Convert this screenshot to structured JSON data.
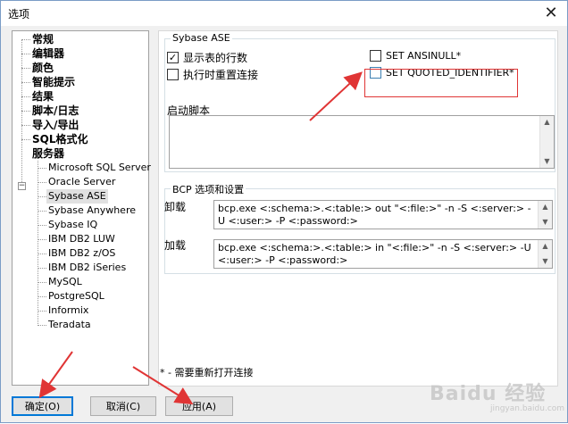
{
  "window": {
    "title": "选项",
    "close_glyph": "✕"
  },
  "nav_tree": {
    "top_items": [
      "常规",
      "编辑器",
      "颜色",
      "智能提示",
      "结果",
      "脚本/日志",
      "导入/导出",
      "SQL格式化",
      "服务器"
    ],
    "expander_glyph": "−",
    "server_children": [
      "Microsoft SQL Server",
      "Oracle Server",
      "Sybase ASE",
      "Sybase Anywhere",
      "Sybase IQ",
      "IBM DB2 LUW",
      "IBM DB2 z/OS",
      "IBM DB2 iSeries",
      "MySQL",
      "PostgreSQL",
      "Informix",
      "Teradata"
    ],
    "selected": "Sybase ASE"
  },
  "sybase_group": {
    "title": "Sybase ASE",
    "show_rowcount": {
      "label": "显示表的行数",
      "checked": true
    },
    "reset_on_exec": {
      "label": "执行时重置连接",
      "checked": false
    },
    "set_ansinull": {
      "label": "SET ANSINULL*",
      "checked": false
    },
    "set_quoted_identifier": {
      "label": "SET QUOTED_IDENTIFIER*",
      "checked": false
    },
    "startup_script_label": "启动脚本",
    "startup_script_value": ""
  },
  "bcp_group": {
    "title": "BCP 选项和设置",
    "unload_label": "卸载",
    "unload_value": "bcp.exe <:schema:>.<:table:> out \"<:file:>\" -n -S <:server:> -U <:user:> -P <:password:>",
    "load_label": "加载",
    "load_value": "bcp.exe <:schema:>.<:table:> in \"<:file:>\" -n -S <:server:> -U <:user:> -P <:password:>"
  },
  "footnote": "* - 需要重新打开连接",
  "buttons": {
    "ok": "确定(O)",
    "cancel": "取消(C)",
    "apply": "应用(A)"
  },
  "watermark": {
    "main": "Baidu 经验",
    "sub": "jingyan.baidu.com"
  },
  "colors": {
    "annotation_red": "#e03535",
    "accent_blue": "#0078d7"
  }
}
